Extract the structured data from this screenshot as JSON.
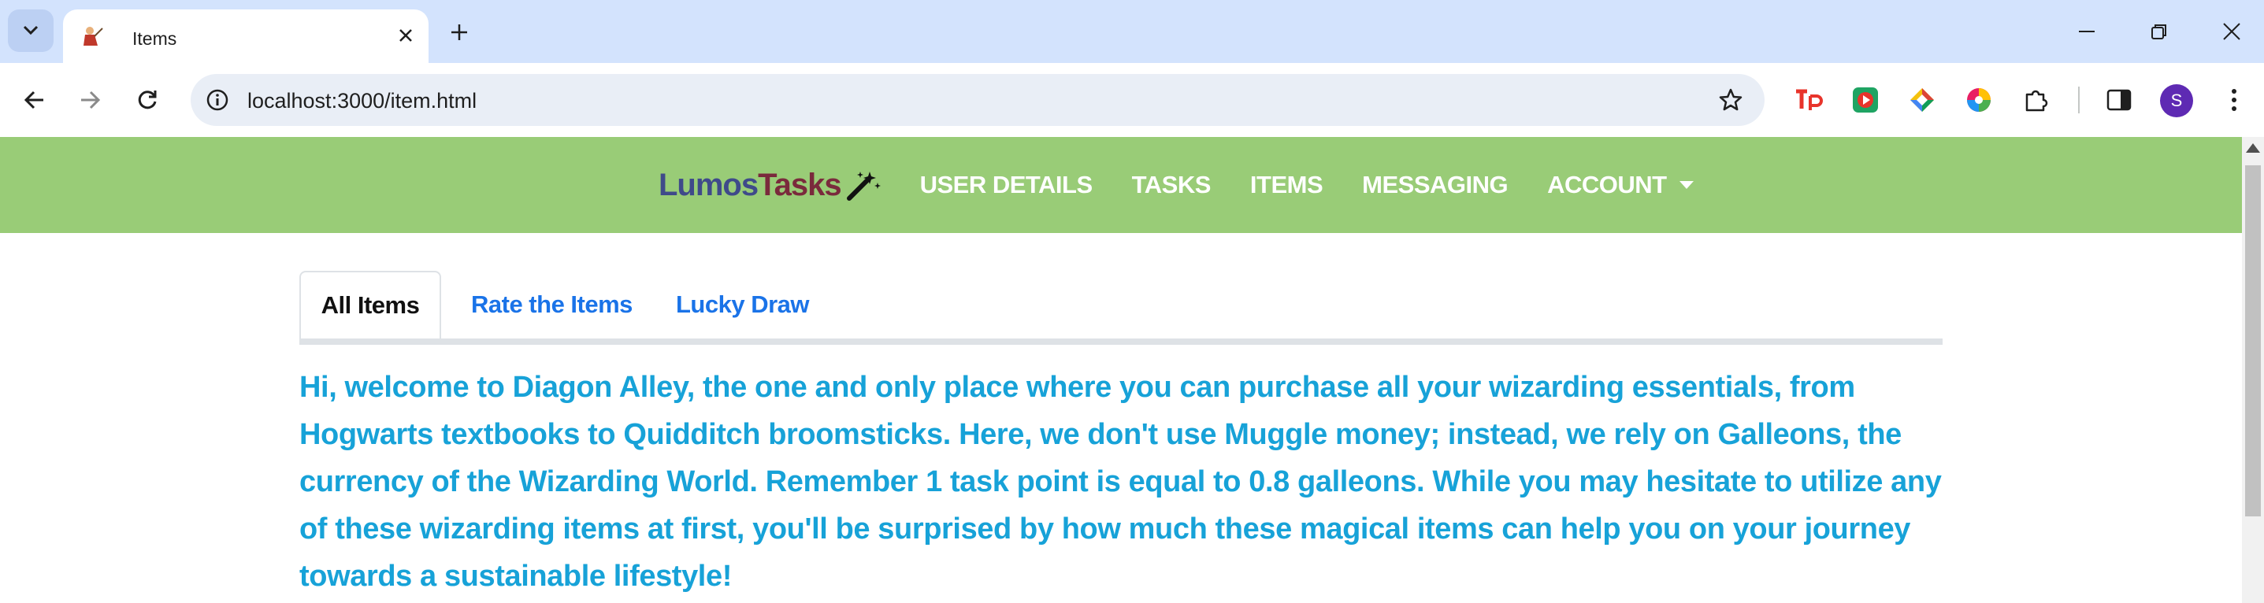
{
  "browser": {
    "tab_title": "Items",
    "url": "localhost:3000/item.html",
    "profile_initial": "S"
  },
  "navbar": {
    "brand_part1": "Lumos",
    "brand_part2": "Tasks",
    "links": [
      "USER DETAILS",
      "TASKS",
      "ITEMS",
      "MESSAGING",
      "ACCOUNT"
    ]
  },
  "tabs": {
    "items": [
      "All Items",
      "Rate the Items",
      "Lucky Draw"
    ],
    "active": "All Items"
  },
  "intro_text": "Hi, welcome to Diagon Alley, the one and only place where you can purchase all your wizarding essentials, from Hogwarts textbooks to Quidditch broomsticks. Here, we don't use Muggle money; instead, we rely on Galleons, the currency of the Wizarding World. Remember 1 task point is equal to 0.8 galleons. While you may hesitate to utilize any of these wizarding items at first, you'll be surprised by how much these magical items can help you on your journey towards a sustainable lifestyle!",
  "colors": {
    "navbar_bg": "#99cc77",
    "intro_text": "#17a2d8",
    "tab_link": "#1a73e8",
    "browser_frame": "#d3e3fd"
  },
  "icons": {
    "brand": "magic-wand-icon",
    "account_dropdown": "caret-down-icon"
  }
}
